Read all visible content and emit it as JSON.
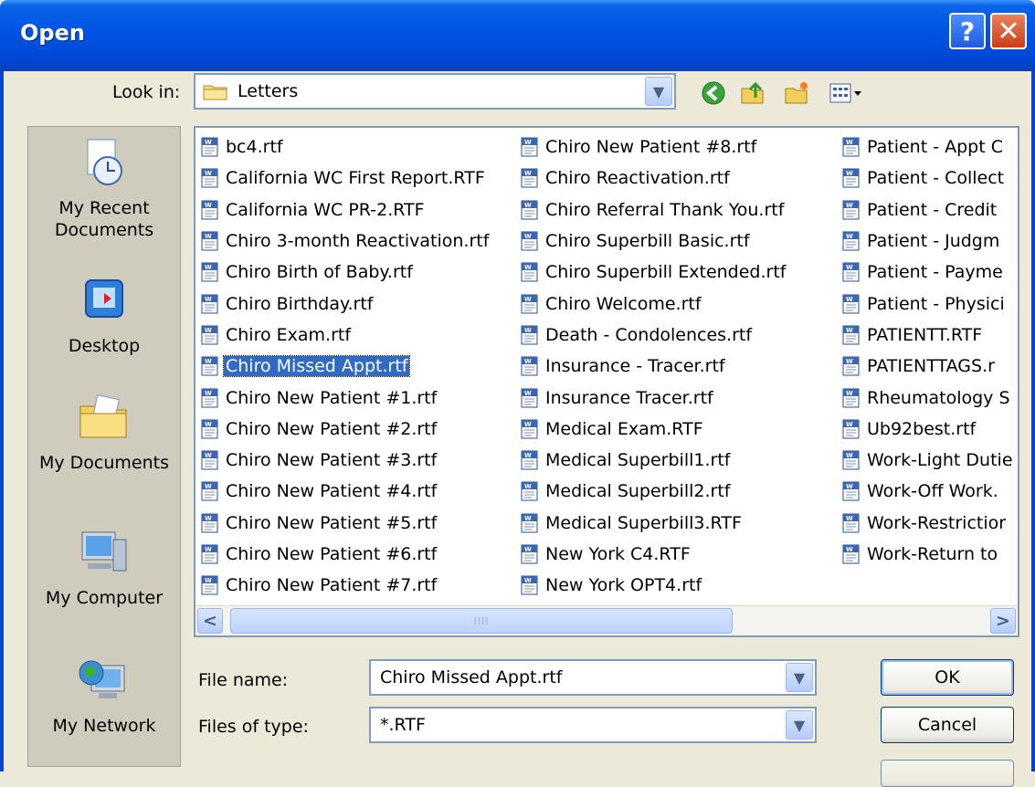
{
  "window": {
    "title": "Open"
  },
  "toolbar": {
    "look_in_label": "Look in:",
    "look_in_value": "Letters"
  },
  "places": [
    "My Recent Documents",
    "Desktop",
    "My Documents",
    "My Computer",
    "My Network"
  ],
  "files": {
    "col1": [
      "bc4.rtf",
      "California WC First Report.RTF",
      "California WC PR-2.RTF",
      "Chiro 3-month Reactivation.rtf",
      "Chiro Birth of Baby.rtf",
      "Chiro Birthday.rtf",
      "Chiro Exam.rtf",
      "Chiro Missed Appt.rtf",
      "Chiro New Patient #1.rtf",
      "Chiro New Patient #2.rtf",
      "Chiro New Patient #3.rtf",
      "Chiro New Patient #4.rtf",
      "Chiro New Patient #5.rtf",
      "Chiro New Patient #6.rtf",
      "Chiro New Patient #7.rtf"
    ],
    "col2": [
      "Chiro New Patient #8.rtf",
      "Chiro Reactivation.rtf",
      "Chiro Referral Thank You.rtf",
      "Chiro Superbill Basic.rtf",
      "Chiro Superbill Extended.rtf",
      "Chiro Welcome.rtf",
      "Death - Condolences.rtf",
      "Insurance - Tracer.rtf",
      "Insurance Tracer.rtf",
      "Medical Exam.RTF",
      "Medical Superbill1.rtf",
      "Medical Superbill2.rtf",
      "Medical Superbill3.RTF",
      "New York C4.RTF",
      "New York OPT4.rtf"
    ],
    "col3": [
      "Patient - Appt C",
      "Patient - Collect",
      "Patient - Credit",
      "Patient - Judgm",
      "Patient - Payme",
      "Patient - Physici",
      "PATIENTT.RTF",
      "PATIENTTAGS.r",
      "Rheumatology S",
      "Ub92best.rtf",
      "Work-Light Dutie",
      "Work-Off Work.",
      "Work-Restrictior",
      "Work-Return to"
    ],
    "selected": "Chiro Missed Appt.rtf"
  },
  "form": {
    "file_name_label": "File name:",
    "file_name_value": "Chiro Missed Appt.rtf",
    "file_type_label": "Files of type:",
    "file_type_value": "*.RTF"
  },
  "buttons": {
    "ok": "OK",
    "cancel": "Cancel"
  },
  "colors": {
    "titlebar": "#0055e5",
    "selection": "#316ac5"
  }
}
